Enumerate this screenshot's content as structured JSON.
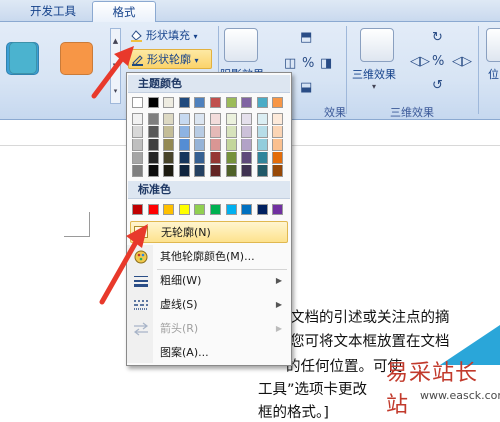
{
  "tabs": [
    {
      "label": "开发工具"
    },
    {
      "label": "格式"
    }
  ],
  "ribbon": {
    "shape_styles": {
      "swatch_colors": [
        "#3c9fd6",
        "#4bb3cf",
        "#f79646"
      ],
      "shape_fill_label": "形状填充",
      "shape_outline_label": "形状轮廓"
    },
    "shadow_button_label": "阴影效果",
    "shadow_group_label": "效果",
    "threed_button_label": "三维效果",
    "threed_group_label": "三维效果",
    "position_label": "位"
  },
  "outline_menu": {
    "theme_colors_header": "主题颜色",
    "theme_colors_top": [
      "#ffffff",
      "#000000",
      "#eeece1",
      "#1f497d",
      "#4f81bd",
      "#c0504d",
      "#9bbb59",
      "#8064a2",
      "#4bacc6",
      "#f79646"
    ],
    "theme_colors_shades": [
      [
        "#f2f2f2",
        "#d8d8d8",
        "#bfbfbf",
        "#a5a5a5",
        "#7f7f7f"
      ],
      [
        "#7f7f7f",
        "#595959",
        "#3f3f3f",
        "#262626",
        "#0c0c0c"
      ],
      [
        "#ddd9c3",
        "#c4bd97",
        "#938953",
        "#494429",
        "#1d1b10"
      ],
      [
        "#c6d9f0",
        "#8db3e2",
        "#548dd4",
        "#17365d",
        "#0f243e"
      ],
      [
        "#dbe5f1",
        "#b8cce4",
        "#95b3d7",
        "#366092",
        "#244061"
      ],
      [
        "#f2dcdb",
        "#e5b9b7",
        "#d99694",
        "#953734",
        "#632423"
      ],
      [
        "#ebf1dd",
        "#d7e3bc",
        "#c3d69b",
        "#76923c",
        "#4f6128"
      ],
      [
        "#e5e0ec",
        "#ccc1d9",
        "#b2a2c7",
        "#5f497a",
        "#3f3151"
      ],
      [
        "#dbeef3",
        "#b7dde8",
        "#92cddc",
        "#31859b",
        "#205867"
      ],
      [
        "#fdeada",
        "#fbd5b5",
        "#fac08f",
        "#e36c09",
        "#974806"
      ]
    ],
    "standard_colors_header": "标准色",
    "standard_colors": [
      "#c00000",
      "#ff0000",
      "#ffc000",
      "#ffff00",
      "#92d050",
      "#00b050",
      "#00b0f0",
      "#0070c0",
      "#002060",
      "#7030a0"
    ],
    "items": [
      {
        "label": "无轮廓(N)",
        "icon": "no-outline-icon"
      },
      {
        "label": "其他轮廓颜色(M)...",
        "icon": "palette-icon"
      },
      {
        "label": "粗细(W)",
        "icon": "line-weight-icon"
      },
      {
        "label": "虚线(S)",
        "icon": "dashes-icon"
      },
      {
        "label": "箭头(R)",
        "icon": "arrows-icon"
      },
      {
        "label": "图案(A)..."
      }
    ]
  },
  "document": {
    "lines": [
      "文档的引述或关注点的摘",
      "您可将文本框放置在文档",
      "的任何位置。可使",
      "工具”选项卡更改",
      "框的格式。]"
    ],
    "watermark": "易采站长站",
    "watermark_url": "www.easck.com"
  },
  "annotation_color": "#e8392b"
}
